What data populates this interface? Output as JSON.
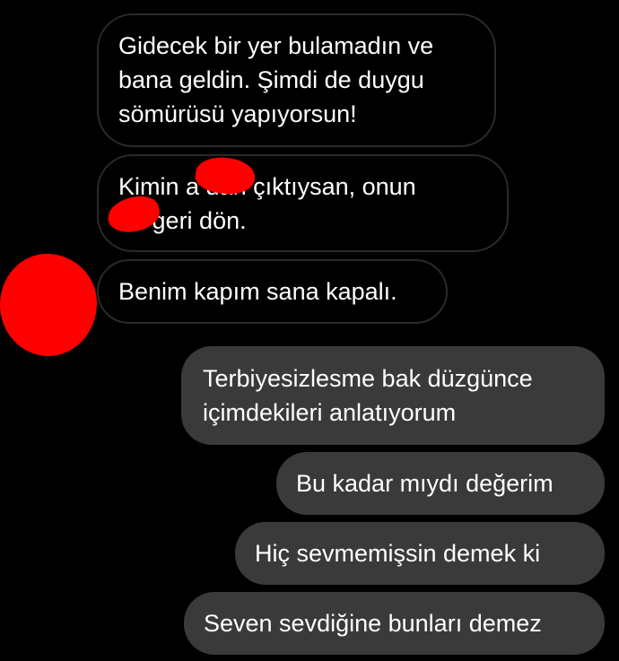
{
  "conversation": {
    "received": [
      {
        "lines": [
          "Gidecek bir yer bulamadın ve",
          "bana geldin. Şimdi de duygu",
          "sömürüsü yapıyorsun!"
        ]
      },
      {
        "lines": [
          "Kimin a          dan çıktıysan, onun",
          "       na geri dön."
        ]
      },
      {
        "lines": [
          "Benim kapım sana kapalı."
        ]
      }
    ],
    "sent": [
      {
        "lines": [
          "Terbiyesizlesme bak düzgünce",
          "içimdekileri anlatıyorum"
        ]
      },
      {
        "lines": [
          "Bu kadar mıydı değerim"
        ]
      },
      {
        "lines": [
          "Hiç sevmemişsin demek ki"
        ]
      },
      {
        "lines": [
          "Seven sevdiğine bunları demez"
        ]
      }
    ]
  },
  "colors": {
    "background": "#000000",
    "received_border": "#2a2a2a",
    "sent_bubble": "#3a3a3a",
    "text": "#ffffff",
    "redaction": "#ff0000"
  }
}
